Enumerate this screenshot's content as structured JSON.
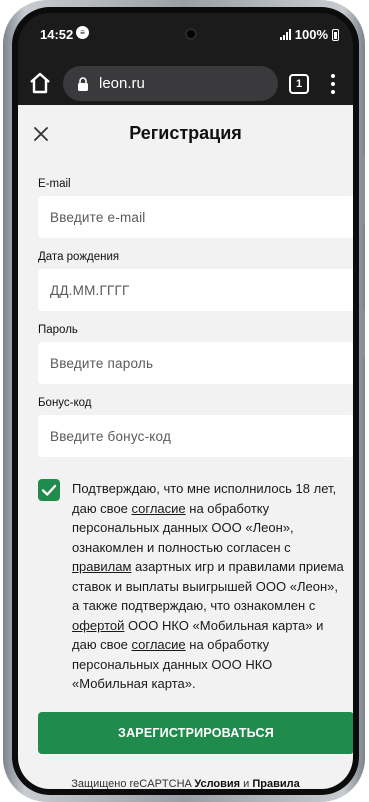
{
  "status_bar": {
    "time": "14:52",
    "battery": "100%"
  },
  "browser": {
    "url": "leon.ru",
    "tab_count": "1"
  },
  "modal": {
    "title": "Регистрация"
  },
  "form": {
    "email": {
      "label": "E-mail",
      "placeholder": "Введите e-mail"
    },
    "birthdate": {
      "label": "Дата рождения",
      "placeholder": "ДД.ММ.ГГГГ"
    },
    "password": {
      "label": "Пароль",
      "placeholder": "Введите пароль"
    },
    "bonus_code": {
      "label": "Бонус-код",
      "placeholder": "Введите бонус-код"
    }
  },
  "consent": {
    "checked": true,
    "text_1": "Подтверждаю, что мне исполнилось 18 лет, даю свое ",
    "link_1": "согласие",
    "text_2": " на обработку персональных данных ООО «Леон», ознакомлен и полностью согласен с ",
    "link_2": "правилам",
    "text_3": " азартных игр и правилами приема ставок и выплаты выигрышей ООО «Леон», а также подтверждаю, что ознакомлен с ",
    "link_3": "офертой",
    "text_4": " ООО НКО «Мобильная карта» и даю свое ",
    "link_4": "согласие",
    "text_5": " на обработку персональных данных ООО НКО «Мобильная карта»."
  },
  "register_button": "ЗАРЕГИСТРИРОВАТЬСЯ",
  "recaptcha": {
    "prefix": "Защищено reCAPTCHA ",
    "terms": "Условия",
    "conjunction": " и ",
    "rules": "Правила"
  },
  "colors": {
    "accent": "#1f8b4c",
    "page_background": "#f2f2f2",
    "browser_chrome": "#1b1b1c"
  },
  "icons": [
    "app-notification-icon",
    "signal-icon",
    "battery-icon",
    "home-icon",
    "lock-icon",
    "tabs-icon",
    "menu-icon",
    "close-icon",
    "checkmark-icon"
  ]
}
